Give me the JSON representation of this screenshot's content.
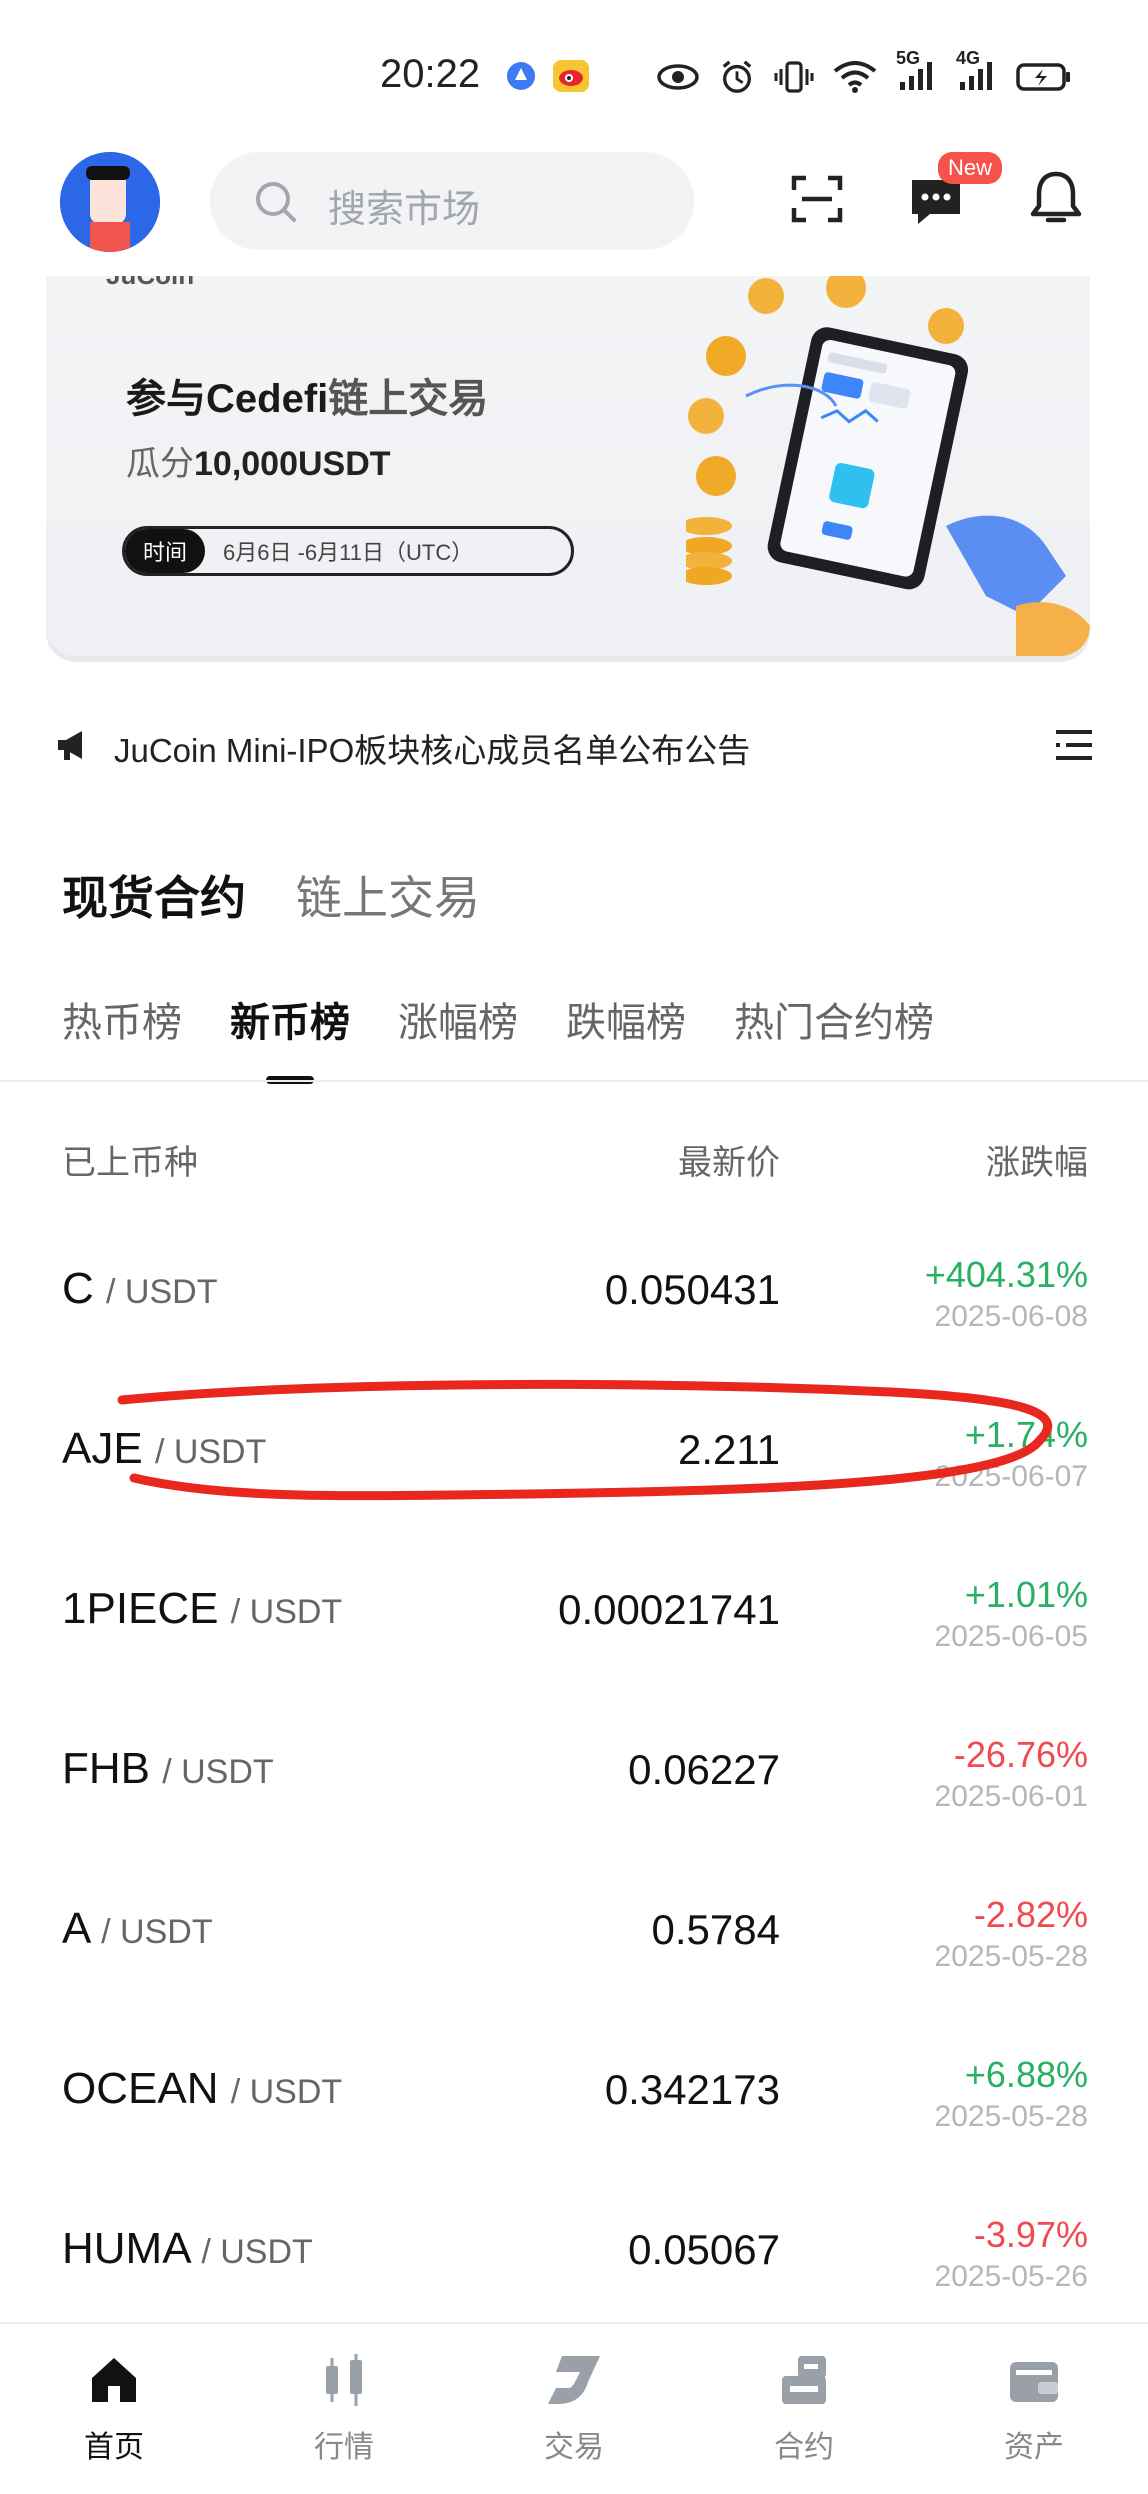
{
  "status_bar": {
    "time": "20:22",
    "network_5g": "5G",
    "network_4g": "4G"
  },
  "header": {
    "search_placeholder": "搜索市场",
    "new_badge": "New"
  },
  "banner": {
    "logo_text": "JuCoin",
    "title_prefix": "参与",
    "title_bold": "Cedefi",
    "title_suffix": "链上交易",
    "sub_prefix": "瓜分",
    "sub_amount": "10,000USDT",
    "time_tag": "时间",
    "time_value": "6月6日 -6月11日（UTC）"
  },
  "announcement": {
    "text": "JuCoin Mini-IPO板块核心成员名单公布公告"
  },
  "section_tabs": [
    {
      "label": "现货合约",
      "active": true
    },
    {
      "label": "链上交易",
      "active": false
    }
  ],
  "sub_tabs": [
    {
      "label": "热币榜",
      "active": false
    },
    {
      "label": "新币榜",
      "active": true
    },
    {
      "label": "涨幅榜",
      "active": false
    },
    {
      "label": "跌幅榜",
      "active": false
    },
    {
      "label": "热门合约榜",
      "active": false
    }
  ],
  "table": {
    "headers": {
      "name": "已上币种",
      "price": "最新价",
      "change": "涨跌幅"
    },
    "rows": [
      {
        "base": "C",
        "quote": "/ USDT",
        "price": "0.050431",
        "change": "+404.31%",
        "date": "2025-06-08",
        "trend": "up"
      },
      {
        "base": "AJE",
        "quote": "/ USDT",
        "price": "2.211",
        "change": "+1.74%",
        "date": "2025-06-07",
        "trend": "up"
      },
      {
        "base": "1PIECE",
        "quote": "/ USDT",
        "price": "0.00021741",
        "change": "+1.01%",
        "date": "2025-06-05",
        "trend": "up"
      },
      {
        "base": "FHB",
        "quote": "/ USDT",
        "price": "0.06227",
        "change": "-26.76%",
        "date": "2025-06-01",
        "trend": "down"
      },
      {
        "base": "A",
        "quote": "/ USDT",
        "price": "0.5784",
        "change": "-2.82%",
        "date": "2025-05-28",
        "trend": "down"
      },
      {
        "base": "OCEAN",
        "quote": "/ USDT",
        "price": "0.342173",
        "change": "+6.88%",
        "date": "2025-05-28",
        "trend": "up"
      },
      {
        "base": "HUMA",
        "quote": "/ USDT",
        "price": "0.05067",
        "change": "-3.97%",
        "date": "2025-05-26",
        "trend": "down"
      }
    ]
  },
  "bottom_nav": [
    {
      "label": "首页",
      "icon": "home-icon",
      "active": true
    },
    {
      "label": "行情",
      "icon": "candlestick-icon",
      "active": false
    },
    {
      "label": "交易",
      "icon": "trade-logo-icon",
      "active": false
    },
    {
      "label": "合约",
      "icon": "contract-icon",
      "active": false
    },
    {
      "label": "资产",
      "icon": "wallet-icon",
      "active": false
    }
  ],
  "colors": {
    "up": "#27b060",
    "down": "#f1494e",
    "annotation": "#e8281e"
  }
}
